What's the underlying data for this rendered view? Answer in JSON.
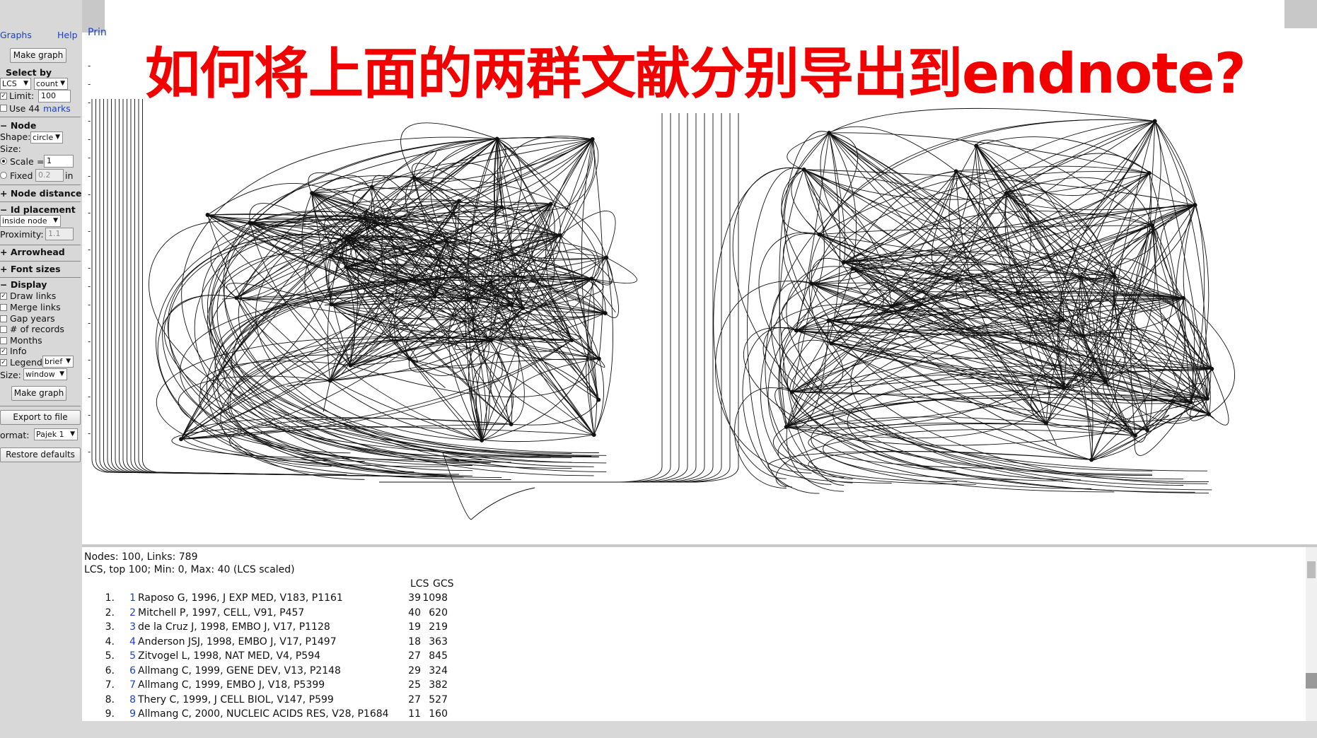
{
  "overlay_question": "如何将上面的两群文献分别导出到endnote?",
  "menu": {
    "graphs": "Graphs",
    "help": "Help",
    "print": "Prin"
  },
  "select_by": {
    "make_graph_top": "Make graph",
    "title": "Select by",
    "metric": "LCS",
    "mode": "count",
    "limit_label": "Limit:",
    "limit_value": "100",
    "use_label": "Use 44",
    "marks_link": "marks"
  },
  "node": {
    "title": "Node",
    "shape_label": "Shape:",
    "shape_value": "circle",
    "size_label": "Size:",
    "scale_label": "Scale",
    "scale_value": "1",
    "fixed_label": "Fixed",
    "fixed_value": "0.2",
    "fixed_unit": "in"
  },
  "node_distance": {
    "title": "Node distance"
  },
  "id_placement": {
    "title": "Id placement",
    "value": "inside node",
    "proximity_label": "Proximity:",
    "proximity_value": "1.1"
  },
  "arrowhead": {
    "title": "Arrowhead"
  },
  "font_sizes": {
    "title": "Font sizes"
  },
  "display": {
    "title": "Display",
    "draw_links": "Draw links",
    "merge_links": "Merge links",
    "gap_years": "Gap years",
    "num_records": "# of records",
    "months": "Months",
    "info": "Info",
    "legend_label": "Legend",
    "legend_value": "brief",
    "size_label": "Size:",
    "size_value": "window",
    "make_graph": "Make graph"
  },
  "export": {
    "button": "Export to file",
    "format_label": "ormat:",
    "format_value": "Pajek 1",
    "restore": "Restore defaults"
  },
  "info": {
    "nodes_links": "Nodes: 100, Links: 789",
    "lcs_line": "LCS, top 100; Min: 0, Max: 40 (LCS scaled)",
    "col_lcs": "LCS",
    "col_gcs": "GCS",
    "records": [
      {
        "n": "1.",
        "id": "1",
        "cite": "Raposo G, 1996, J EXP MED, V183, P1161",
        "lcs": "39",
        "gcs": "1098"
      },
      {
        "n": "2.",
        "id": "2",
        "cite": "Mitchell P, 1997, CELL, V91, P457",
        "lcs": "40",
        "gcs": "620"
      },
      {
        "n": "3.",
        "id": "3",
        "cite": "de la Cruz J, 1998, EMBO J, V17, P1128",
        "lcs": "19",
        "gcs": "219"
      },
      {
        "n": "4.",
        "id": "4",
        "cite": "Anderson JSJ, 1998, EMBO J, V17, P1497",
        "lcs": "18",
        "gcs": "363"
      },
      {
        "n": "5.",
        "id": "5",
        "cite": "Zitvogel L, 1998, NAT MED, V4, P594",
        "lcs": "27",
        "gcs": "845"
      },
      {
        "n": "6.",
        "id": "6",
        "cite": "Allmang C, 1999, GENE DEV, V13, P2148",
        "lcs": "29",
        "gcs": "324"
      },
      {
        "n": "7.",
        "id": "7",
        "cite": "Allmang C, 1999, EMBO J, V18, P5399",
        "lcs": "25",
        "gcs": "382"
      },
      {
        "n": "8.",
        "id": "8",
        "cite": "Thery C, 1999, J CELL BIOL, V147, P599",
        "lcs": "27",
        "gcs": "527"
      },
      {
        "n": "9.",
        "id": "9",
        "cite": "Allmang C, 2000, NUCLEIC ACIDS RES, V28, P1684",
        "lcs": "11",
        "gcs": "160"
      }
    ]
  },
  "colors": {
    "overlay_text": "#f20000",
    "link": "#1a3fc8",
    "panel_bg": "#d8d8d8"
  }
}
